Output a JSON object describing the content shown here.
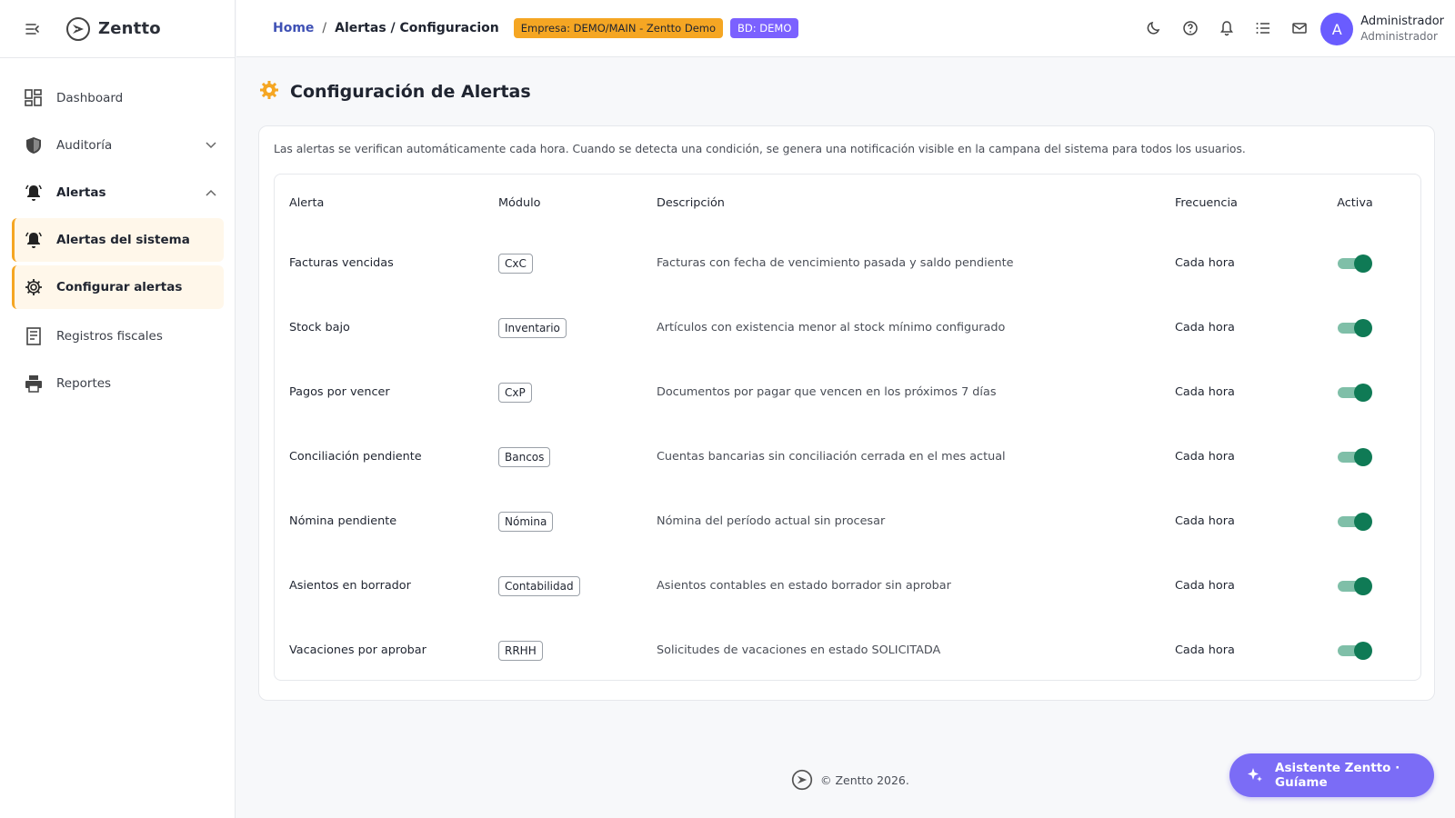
{
  "app": {
    "name": "Zentto"
  },
  "sidebar": {
    "items": [
      {
        "label": "Dashboard",
        "icon": "dashboard-icon"
      },
      {
        "label": "Auditoría",
        "icon": "shield-icon"
      },
      {
        "label": "Alertas",
        "icon": "bell-icon"
      },
      {
        "label": "Alertas del sistema",
        "icon": "bell-icon"
      },
      {
        "label": "Configurar alertas",
        "icon": "gear-icon"
      },
      {
        "label": "Registros fiscales",
        "icon": "receipt-icon"
      },
      {
        "label": "Reportes",
        "icon": "printer-icon"
      }
    ]
  },
  "header": {
    "breadcrumb": {
      "home": "Home",
      "separator": "/",
      "current": "Alertas / Configuracion"
    },
    "badge_org": "Empresa: DEMO/MAIN - Zentto Demo",
    "badge_db": "BD: DEMO",
    "user": {
      "initial": "A",
      "name": "Administrador",
      "role": "Administrador"
    }
  },
  "main": {
    "title": "Configuración de Alertas",
    "info": "Las alertas se verifican automáticamente cada hora. Cuando se detecta una condición, se genera una notificación visible en la campana del sistema para todos los usuarios.",
    "table": {
      "headers": [
        "Alerta",
        "Módulo",
        "Descripción",
        "Frecuencia",
        "Activa"
      ],
      "rows": [
        {
          "alerta": "Facturas vencidas",
          "modulo": "CxC",
          "descripcion": "Facturas con fecha de vencimiento pasada y saldo pendiente",
          "frecuencia": "Cada hora",
          "activa": true
        },
        {
          "alerta": "Stock bajo",
          "modulo": "Inventario",
          "descripcion": "Artículos con existencia menor al stock mínimo configurado",
          "frecuencia": "Cada hora",
          "activa": true
        },
        {
          "alerta": "Pagos por vencer",
          "modulo": "CxP",
          "descripcion": "Documentos por pagar que vencen en los próximos 7 días",
          "frecuencia": "Cada hora",
          "activa": true
        },
        {
          "alerta": "Conciliación pendiente",
          "modulo": "Bancos",
          "descripcion": "Cuentas bancarias sin conciliación cerrada en el mes actual",
          "frecuencia": "Cada hora",
          "activa": true
        },
        {
          "alerta": "Nómina pendiente",
          "modulo": "Nómina",
          "descripcion": "Nómina del período actual sin procesar",
          "frecuencia": "Cada hora",
          "activa": true
        },
        {
          "alerta": "Asientos en borrador",
          "modulo": "Contabilidad",
          "descripcion": "Asientos contables en estado borrador sin aprobar",
          "frecuencia": "Cada hora",
          "activa": true
        },
        {
          "alerta": "Vacaciones por aprobar",
          "modulo": "RRHH",
          "descripcion": "Solicitudes de vacaciones en estado SOLICITADA",
          "frecuencia": "Cada hora",
          "activa": true
        }
      ]
    }
  },
  "footer": {
    "text": "© Zentto 2026."
  },
  "assistant": {
    "label": "Asistente Zentto · Guíame"
  },
  "colors": {
    "accent": "#f5a623",
    "primary": "#3f51b5",
    "toggle_on": "#0f7a55",
    "fab": "#7b6cf6"
  }
}
